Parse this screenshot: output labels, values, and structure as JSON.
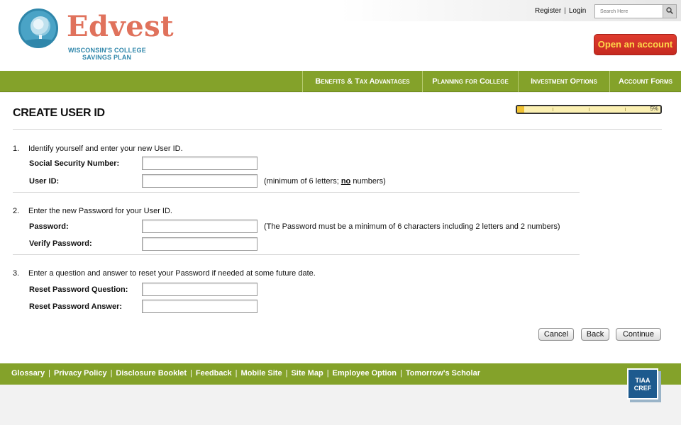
{
  "header": {
    "logo": {
      "word": "Edvest",
      "tm": "™",
      "sub_line1": "WISCONSIN'S COLLEGE",
      "sub_line2": "SAVINGS PLAN"
    },
    "register_label": "Register",
    "separator": "|",
    "login_label": "Login",
    "search": {
      "placeholder": "Search Here",
      "button_icon": "search-icon"
    },
    "open_account_label": "Open an account"
  },
  "nav": {
    "items": [
      {
        "label": "Benefits & Tax Advantages"
      },
      {
        "label": "Planning for College"
      },
      {
        "label": "Investment Options"
      },
      {
        "label": "Account Forms"
      }
    ]
  },
  "main": {
    "title": "CREATE USER ID",
    "progress": {
      "percent": 5,
      "label": "5%"
    },
    "steps": [
      {
        "number": "1.",
        "text": "Identify yourself and enter your new User ID.",
        "fields": [
          {
            "label": "Social Security Number:",
            "value": ""
          },
          {
            "label": "User ID:",
            "value": "",
            "hint_prefix": "(minimum of 6 letters; ",
            "hint_bold": "no",
            "hint_suffix": " numbers)"
          }
        ]
      },
      {
        "number": "2.",
        "text": "Enter the new Password for your User ID.",
        "fields": [
          {
            "label": "Password:",
            "value": "",
            "hint": "(The Password must be a minimum of 6 characters including 2 letters and 2 numbers)"
          },
          {
            "label": "Verify Password:",
            "value": ""
          }
        ]
      },
      {
        "number": "3.",
        "text": "Enter a question and answer to reset your Password if needed at some future date.",
        "fields": [
          {
            "label": "Reset Password Question:",
            "value": ""
          },
          {
            "label": "Reset Password Answer:",
            "value": ""
          }
        ]
      }
    ],
    "buttons": {
      "cancel": "Cancel",
      "back": "Back",
      "continue": "Continue"
    }
  },
  "footer": {
    "links": [
      "Glossary",
      "Privacy Policy",
      "Disclosure Booklet",
      "Feedback",
      "Mobile Site",
      "Site Map",
      "Employee Option",
      "Tomorrow's Scholar"
    ],
    "separator": "|",
    "badge": {
      "line1": "TIAA",
      "line2": "CREF"
    }
  },
  "colors": {
    "nav_green": "#84a22a",
    "brand_coral": "#e0725c",
    "brand_blue": "#2f86aa",
    "cta_red": "#d0322a",
    "cta_text": "#ffd84a"
  }
}
